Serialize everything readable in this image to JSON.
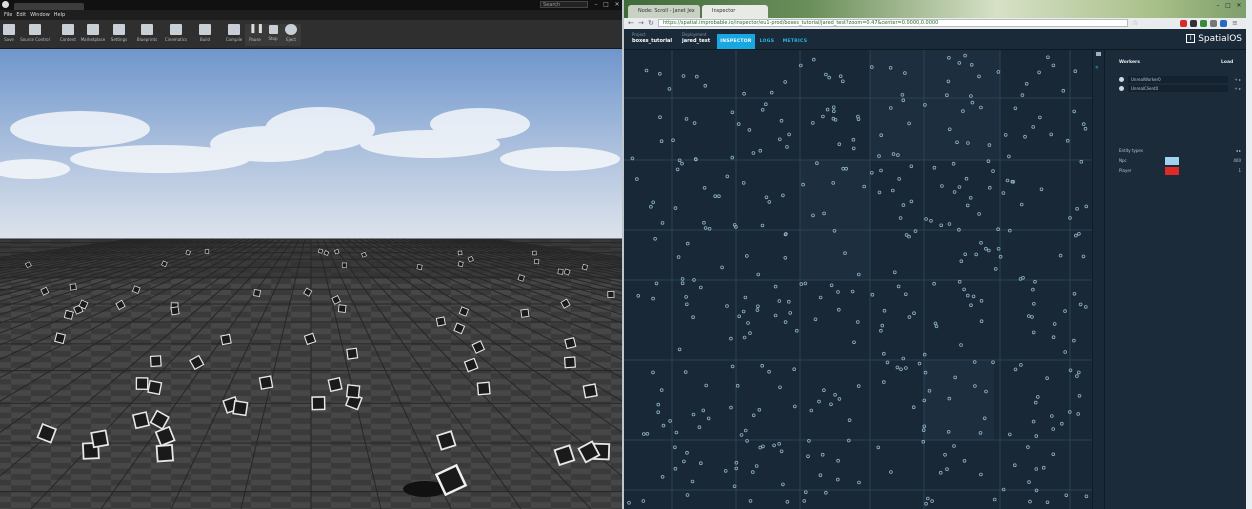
{
  "ue": {
    "search_placeholder": "Search",
    "menu": [
      "File",
      "Edit",
      "Window",
      "Help"
    ],
    "toolbar": [
      "Save",
      "Source Control",
      "Content",
      "Marketplace",
      "Settings",
      "Blueprints",
      "Cinematics",
      "Build",
      "Compile",
      "Pause",
      "Stop",
      "Eject"
    ]
  },
  "browser": {
    "tabs": [
      {
        "label": "Node: Scroll - Janet Jex",
        "active": false
      },
      {
        "label": "Inspector",
        "active": true
      }
    ],
    "url": "https://spatial.improbable.io/inspector/eu1-prod/boxes_tutorial/jared_test?zoom=0.47&center=0.0000,0.0000"
  },
  "app": {
    "project_label": "Project",
    "project_name": "boxes_tutorial",
    "deployment_label": "Deployment",
    "deployment_name": "jared_test",
    "nav": [
      {
        "label": "INSPECTOR",
        "active": true
      },
      {
        "label": "LOGS",
        "active": false
      },
      {
        "label": "METRICS",
        "active": false
      }
    ],
    "logo_text": "SpatialOS",
    "logo_mark": "I"
  },
  "sidebar": {
    "workers_title": "Workers",
    "load_title": "Load",
    "workers": [
      {
        "name": "UnrealWorker0"
      },
      {
        "name": "UnrealClient0"
      }
    ],
    "entity_types_title": "Entity types",
    "entity_types": [
      {
        "name": "Npc",
        "color": "#9fd3ee",
        "count": "400"
      },
      {
        "name": "Player",
        "color": "#e02a2a",
        "count": "1"
      }
    ]
  },
  "colors": {
    "map_bg": "#192836",
    "accent": "#18a7e0",
    "entity_dot": "#8fb3c9"
  }
}
